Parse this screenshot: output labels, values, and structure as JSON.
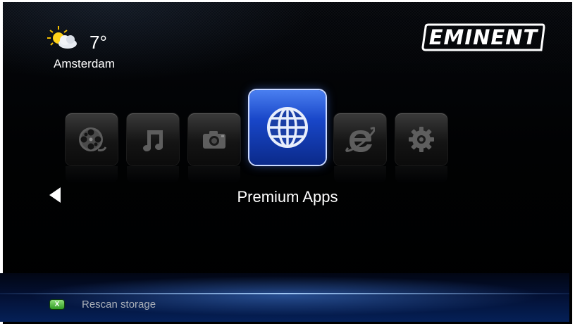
{
  "weather": {
    "icon": "partly-sunny-icon",
    "temperature": "7°",
    "city": "Amsterdam"
  },
  "brand": {
    "logo_text": "EMINENT"
  },
  "menu": {
    "items": [
      {
        "name": "movies",
        "icon": "film-reel-icon",
        "active": false
      },
      {
        "name": "music",
        "icon": "music-note-icon",
        "active": false
      },
      {
        "name": "photos",
        "icon": "camera-icon",
        "active": false
      },
      {
        "name": "premium-apps",
        "icon": "globe-icon",
        "active": true
      },
      {
        "name": "internet",
        "icon": "internet-explorer-icon",
        "active": false
      },
      {
        "name": "settings",
        "icon": "gear-icon",
        "active": false
      }
    ],
    "selected_label": "Premium Apps",
    "nav_left_icon": "arrow-left-icon"
  },
  "footer": {
    "button_key": "X",
    "button_icon": "green-x-button-icon",
    "action_label": "Rescan storage"
  },
  "colors": {
    "accent": "#1846c8",
    "button_green": "#2f9b23"
  }
}
